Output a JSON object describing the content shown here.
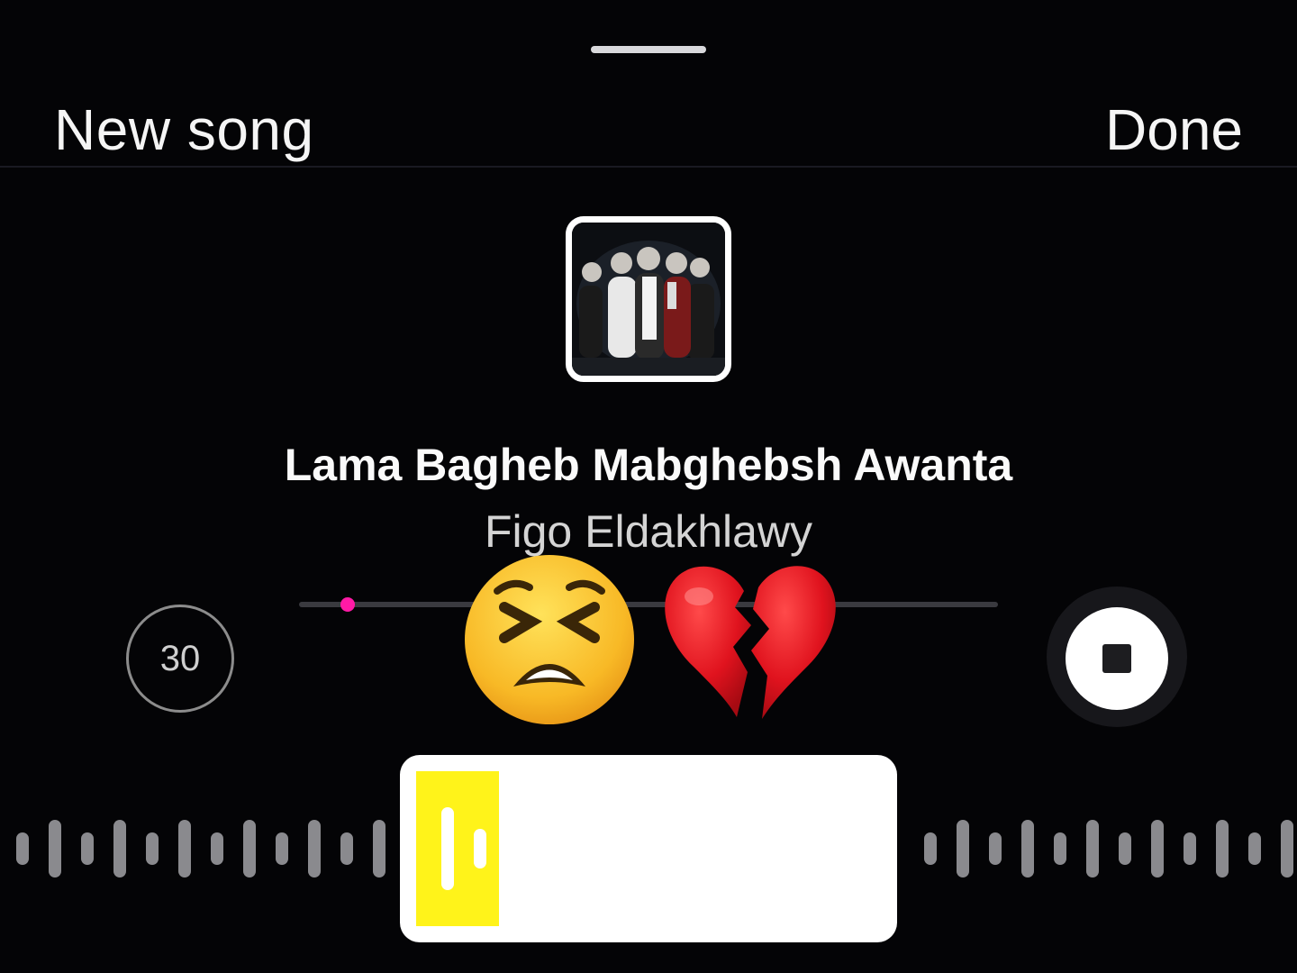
{
  "header": {
    "title": "New song",
    "done_label": "Done"
  },
  "track": {
    "title": "Lama Bagheb Mabghebsh Awanta",
    "artist": "Figo Eldakhlawy"
  },
  "controls": {
    "duration_label": "30",
    "playback_state": "playing",
    "scrub_position": 0.07
  },
  "overlay_emojis": [
    "weary-face",
    "broken-heart"
  ],
  "colors": {
    "accent_pink": "#ff1aa6",
    "selection_yellow": "#fff31a",
    "waveform_gray": "#8a8a8e"
  }
}
